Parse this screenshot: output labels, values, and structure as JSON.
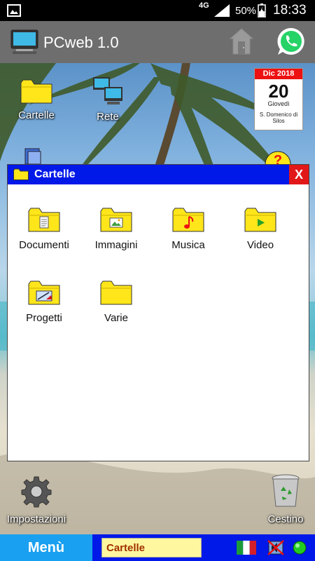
{
  "status_bar": {
    "network": "4G",
    "battery": "50%",
    "time": "18:33"
  },
  "app_bar": {
    "title": "PCweb 1.0"
  },
  "desktop": {
    "icons": [
      {
        "label": "Cartelle",
        "icon": "folder-icon"
      },
      {
        "label": "Rete",
        "icon": "network-icon"
      },
      {
        "label": "Impostazioni",
        "icon": "gear-icon"
      },
      {
        "label": "Cestino",
        "icon": "recycle-bin-icon"
      }
    ],
    "calendar": {
      "month_year": "Dic 2018",
      "day": "20",
      "weekday": "Giovedì",
      "saint": "S. Domenico di Silos"
    }
  },
  "window": {
    "title": "Cartelle",
    "close_label": "X",
    "folders": [
      {
        "label": "Documenti",
        "icon": "documents-folder-icon"
      },
      {
        "label": "Immagini",
        "icon": "images-folder-icon"
      },
      {
        "label": "Musica",
        "icon": "music-folder-icon"
      },
      {
        "label": "Video",
        "icon": "video-folder-icon"
      },
      {
        "label": "Progetti",
        "icon": "projects-folder-icon"
      },
      {
        "label": "Varie",
        "icon": "misc-folder-icon"
      }
    ]
  },
  "taskbar": {
    "menu_label": "Menù",
    "task_label": "Cartelle"
  },
  "colors": {
    "window_titlebar": "#0018e8",
    "close_button": "#e21818",
    "menu_button": "#1aa0f0",
    "folder": "#ffe61a"
  }
}
